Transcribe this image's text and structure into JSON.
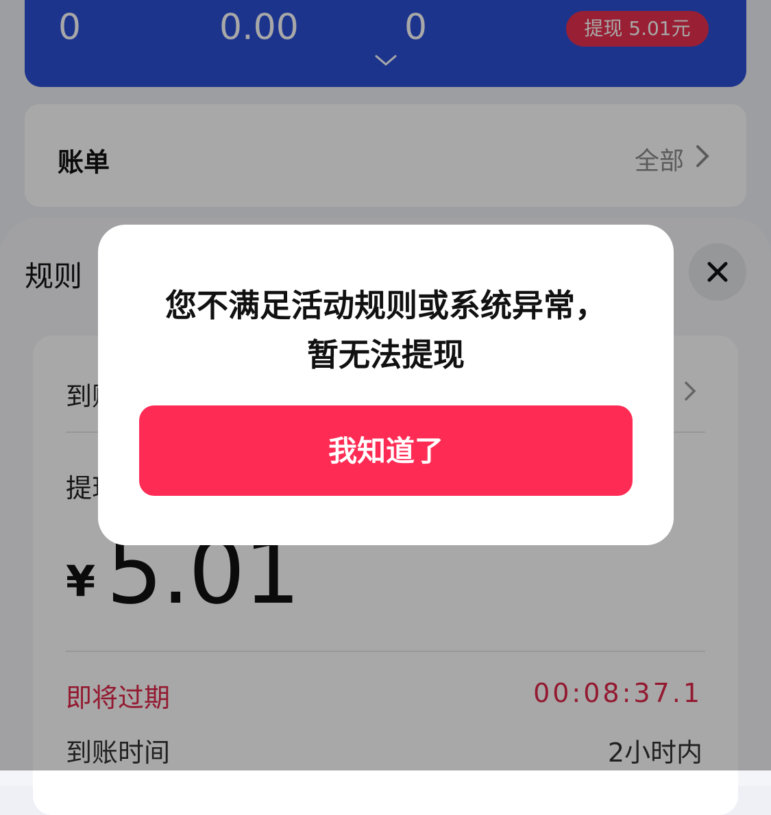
{
  "stats": {
    "value_1": "0",
    "value_2": "0.00",
    "value_3": "0",
    "withdraw_button": "提现 5.01元"
  },
  "bill": {
    "title": "账单",
    "all_link": "全部"
  },
  "rules_sheet": {
    "title": "规则",
    "row_1_label": "到账",
    "row_2_label": "提现",
    "currency": "¥",
    "amount": "5.01",
    "expire_label": "即将过期",
    "expire_countdown": "00:08:37.1",
    "arrival_label": "到账时间",
    "arrival_value": "2小时内"
  },
  "dialog": {
    "message_line_1": "您不满足活动规则或系统异常，",
    "message_line_2": "暂无法提现",
    "confirm_button": "我知道了"
  },
  "colors": {
    "accent_blue": "#2d4fd6",
    "accent_red": "#fe2c55",
    "warning_red": "#e0274a"
  },
  "icons": [
    "chevron-down-icon",
    "chevron-right-icon",
    "close-icon"
  ]
}
